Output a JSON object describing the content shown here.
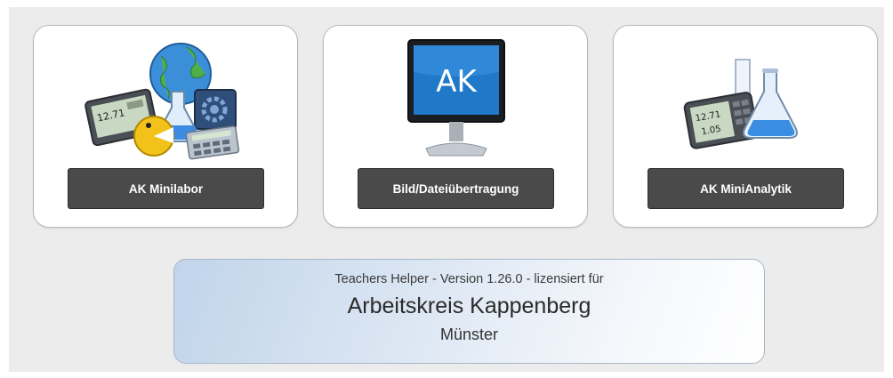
{
  "cards": [
    {
      "label": "AK Minilabor",
      "icon": "minilabor-icon"
    },
    {
      "label": "Bild/Dateiübertragung",
      "icon": "monitor-ak-icon",
      "screen_text": "AK"
    },
    {
      "label": "AK MiniAnalytik",
      "icon": "minianalytik-icon"
    }
  ],
  "device": {
    "readout_top": "12.71",
    "readout_bottom": "1.05"
  },
  "license": {
    "line1": "Teachers Helper - Version 1.26.0 - lizensiert für",
    "organization": "Arbeitskreis Kappenberg",
    "city": "Münster"
  },
  "colors": {
    "background": "#ececec",
    "button": "#4a4a4a",
    "button_text": "#ffffff",
    "license_gradient_start": "#c1d4ea"
  }
}
